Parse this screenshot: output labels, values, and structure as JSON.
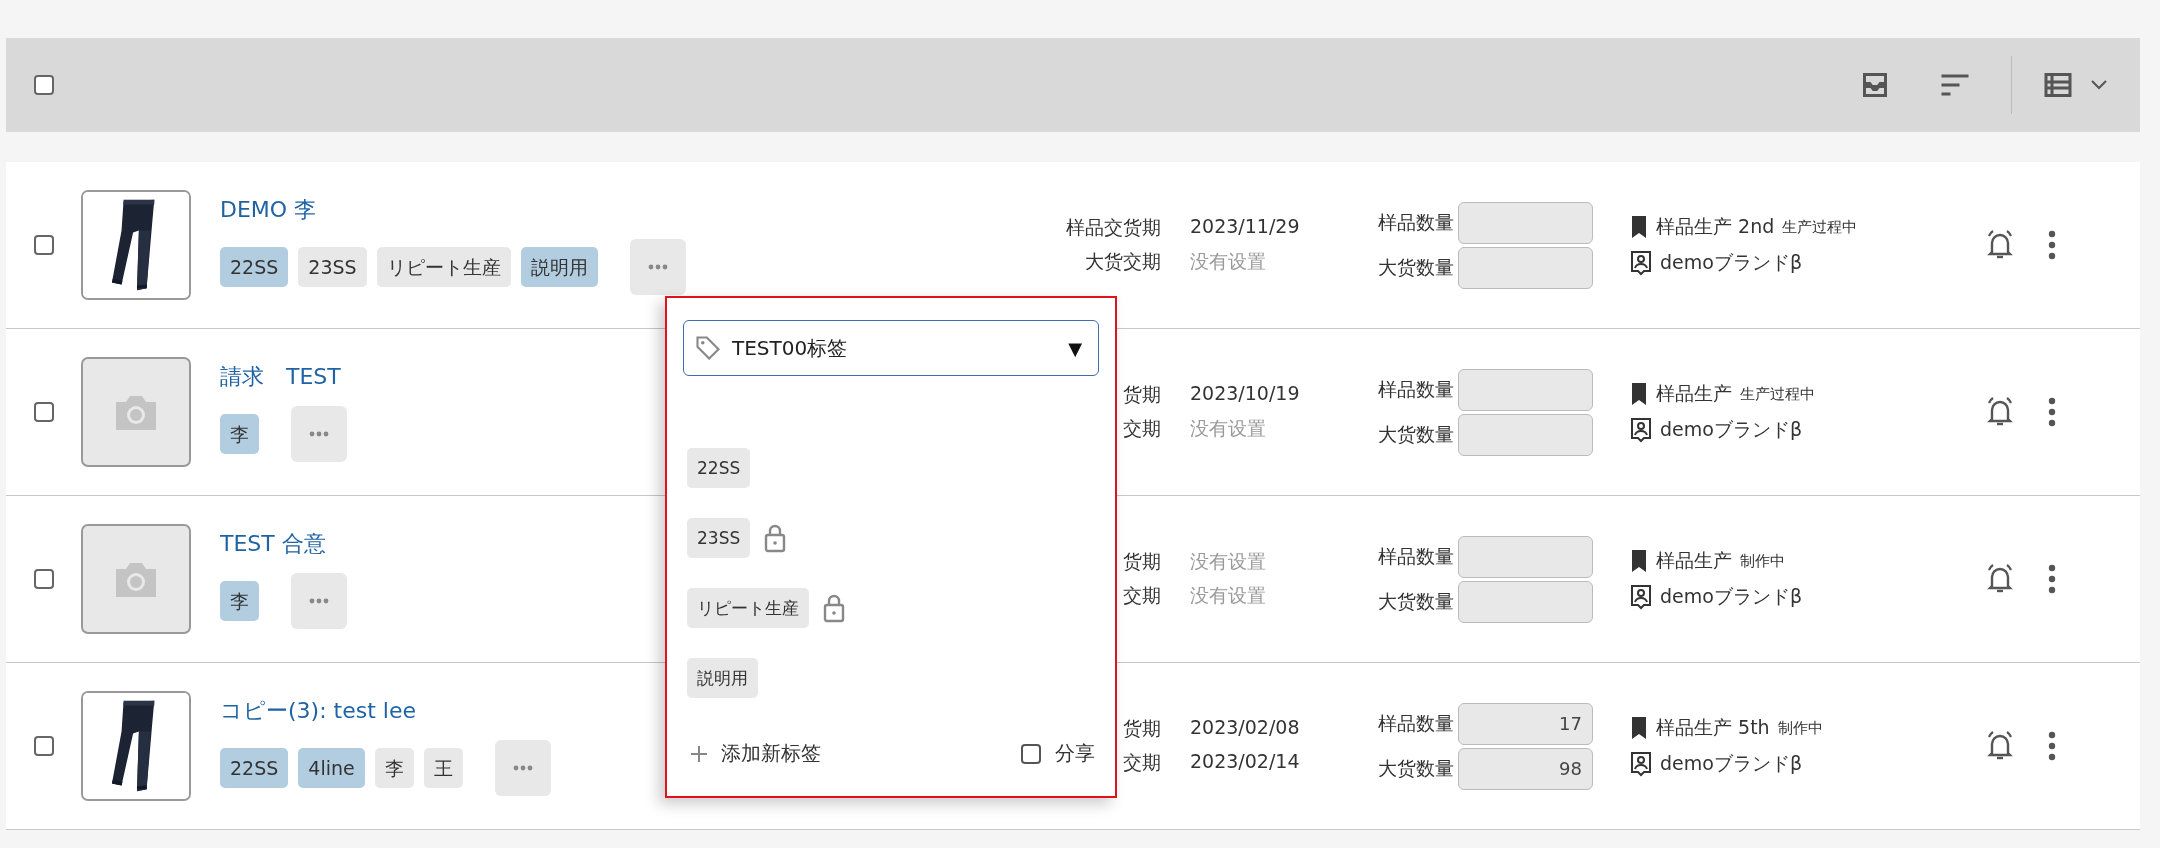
{
  "toolbar": {
    "select_all": {
      "checked": false
    }
  },
  "rows": [
    {
      "checked": false,
      "title": "DEMO 李",
      "tags": [
        {
          "label": "22SS",
          "highlighted": true
        },
        {
          "label": "23SS",
          "highlighted": false
        },
        {
          "label": "リピート生産",
          "highlighted": false
        },
        {
          "label": "説明用",
          "highlighted": true
        }
      ],
      "dates": [
        {
          "label": "样品交货期",
          "value": "2023/11/29",
          "unset": false
        },
        {
          "label": "大货交期",
          "value": "没有设置",
          "unset": true
        }
      ],
      "quantities": [
        {
          "label": "样品数量"
        },
        {
          "label": "大货数量"
        }
      ],
      "stage": "样品生产 2nd",
      "stage_note": "生产过程中",
      "brand": "demoブランドβ"
    },
    {
      "checked": false,
      "image": {
        "kind": "placeholder"
      },
      "title": "請求　TEST",
      "tags": [
        {
          "label": "李",
          "highlighted": true
        }
      ],
      "dates": [
        {
          "label": "货期",
          "value": "2023/10/19",
          "unset": false
        },
        {
          "label": "交期",
          "value": "没有设置",
          "unset": true
        }
      ],
      "quantities": [
        {
          "label": "样品数量"
        },
        {
          "label": "大货数量"
        }
      ],
      "stage": "样品生产",
      "stage_note": "生产过程中",
      "brand": "demoブランドβ"
    },
    {
      "checked": false,
      "image": {
        "kind": "placeholder"
      },
      "title": "TEST 合意",
      "tags": [
        {
          "label": "李",
          "highlighted": true
        }
      ],
      "dates": [
        {
          "label": "货期",
          "value": "没有设置",
          "unset": true
        },
        {
          "label": "交期",
          "value": "没有设置",
          "unset": true
        }
      ],
      "quantities": [
        {
          "label": "样品数量"
        },
        {
          "label": "大货数量"
        }
      ],
      "stage": "样品生产",
      "stage_note": "制作中",
      "brand": "demoブランドβ"
    },
    {
      "checked": false,
      "title": "コピー(3): test lee",
      "tags": [
        {
          "label": "22SS",
          "highlighted": true
        },
        {
          "label": "4line",
          "highlighted": true
        },
        {
          "label": "李",
          "highlighted": false
        },
        {
          "label": "王",
          "highlighted": false
        }
      ],
      "dates": [
        {
          "label": "货期",
          "value": "2023/02/08",
          "unset": false
        },
        {
          "label": "交期",
          "value": "2023/02/14",
          "unset": false
        }
      ],
      "quantities": [
        {
          "label": "样品数量",
          "value": "17"
        },
        {
          "label": "大货数量",
          "value": "98"
        }
      ],
      "stage": "样品生产 5th",
      "stage_note": "制作中",
      "brand": "demoブランドβ"
    }
  ],
  "tag_popup": {
    "select": {
      "value": "TEST00标签",
      "arrow": "▼"
    },
    "tags": [
      {
        "label": "22SS",
        "locked": false
      },
      {
        "label": "23SS",
        "locked": true
      },
      {
        "label": "リピート生産",
        "locked": true
      },
      {
        "label": "説明用",
        "locked": false
      }
    ],
    "add_label": "添加新标签",
    "share": {
      "label": "分享",
      "checked": false
    }
  }
}
